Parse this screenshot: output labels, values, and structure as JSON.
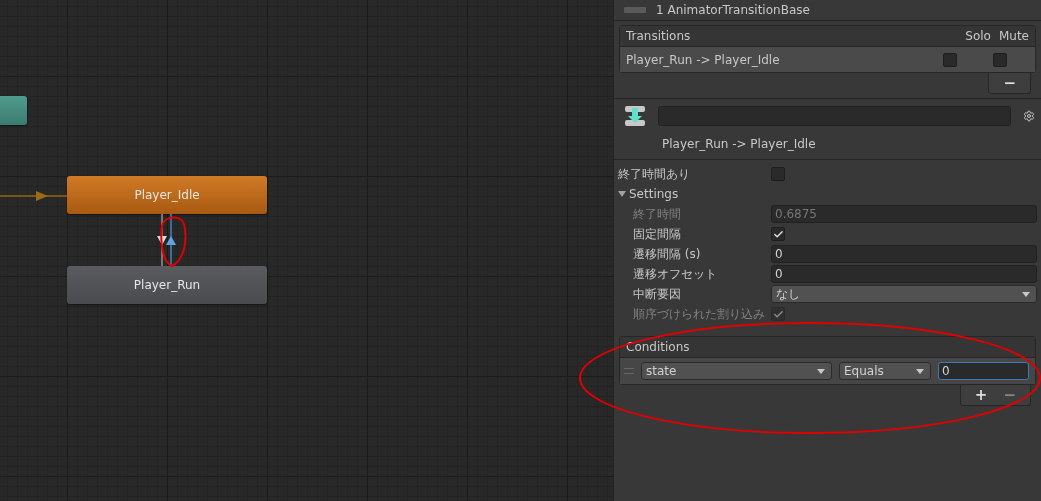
{
  "graph": {
    "nodes": [
      {
        "kind": "entry"
      },
      {
        "kind": "default",
        "label": "Player_Idle"
      },
      {
        "kind": "normal",
        "label": "Player_Run"
      }
    ],
    "transitions": [
      {
        "kind": "down",
        "selected": false
      },
      {
        "kind": "up",
        "selected": true
      }
    ]
  },
  "inspector": {
    "header": "1 AnimatorTransitionBase",
    "transitions": {
      "title": "Transitions",
      "columns": [
        "Solo",
        "Mute"
      ],
      "rows": [
        {
          "label": "Player_Run -> Player_Idle",
          "selected": true,
          "solo": false,
          "mute": false
        }
      ],
      "remove_button": "−"
    },
    "transition": {
      "title": "Player_Run -> Player_Idle"
    },
    "has_exit_time": {
      "label": "終了時間あり",
      "checked": false
    },
    "settings": {
      "label": "Settings",
      "expanded": true,
      "fields": [
        {
          "kind": "number",
          "label": "終了時間",
          "value": "0.6875",
          "disabled": true
        },
        {
          "kind": "checkbox",
          "label": "固定間隔",
          "checked": true,
          "disabled": false
        },
        {
          "kind": "number",
          "label": "遷移間隔 (s)",
          "value": "0",
          "disabled": false
        },
        {
          "kind": "number",
          "label": "遷移オフセット",
          "value": "0",
          "disabled": false
        },
        {
          "kind": "dropdown",
          "label": "中断要因",
          "value": "なし",
          "disabled": false
        },
        {
          "kind": "checkbox",
          "label": "順序づけられた割り込み",
          "checked": true,
          "disabled": true
        }
      ]
    },
    "conditions": {
      "title": "Conditions",
      "rows": [
        {
          "parameter": "state",
          "mode": "Equals",
          "value": "0",
          "focused": true
        }
      ],
      "add_button": "+",
      "remove_button": "−"
    }
  }
}
